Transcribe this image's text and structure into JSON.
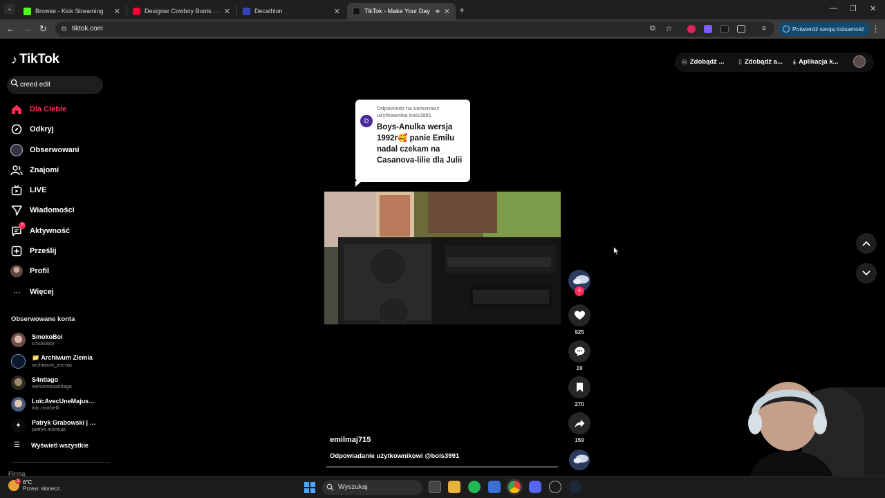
{
  "browser": {
    "tabs": [
      {
        "title": "Browse - Kick Streaming",
        "active": false
      },
      {
        "title": "Designer Cowboy Boots - YouTube",
        "active": false
      },
      {
        "title": "Decathlon",
        "active": false
      },
      {
        "title": "TikTok - Make Your Day",
        "active": true
      }
    ],
    "url": "tiktok.com",
    "verify_label": "Potwierdź swoją tożsamość"
  },
  "tiktok": {
    "logo_text": "TikTok",
    "search_value": "creed edit",
    "nav": [
      {
        "label": "Dla Ciebie",
        "icon": "home-icon",
        "active": true
      },
      {
        "label": "Odkryj",
        "icon": "compass-icon",
        "active": false
      },
      {
        "label": "Obserwowani",
        "icon": "following-avatar-icon",
        "active": false
      },
      {
        "label": "Znajomi",
        "icon": "friends-icon",
        "active": false
      },
      {
        "label": "LIVE",
        "icon": "live-icon",
        "active": false
      },
      {
        "label": "Wiadomości",
        "icon": "send-icon",
        "active": false
      },
      {
        "label": "Aktywność",
        "icon": "activity-icon",
        "active": false,
        "badge": "7"
      },
      {
        "label": "Prześlij",
        "icon": "upload-icon",
        "active": false
      },
      {
        "label": "Profil",
        "icon": "profile-avatar-icon",
        "active": false
      },
      {
        "label": "Więcej",
        "icon": "more-icon",
        "active": false
      }
    ],
    "following_title": "Obserwowane konta",
    "following": [
      {
        "name": "SmokoBoi",
        "handle": "smokoboi"
      },
      {
        "name": "📁 Archiwum Ziemia",
        "handle": "archiwum_ziemia"
      },
      {
        "name": "S4ntIago",
        "handle": "welcomesantiago"
      },
      {
        "name": "LoïcAvecUneMajuscule",
        "handle": "loic.morbelli"
      },
      {
        "name": "Patryk Grabowski | Montaż",
        "handle": "patryk.montuje"
      }
    ],
    "show_all": "Wyświetl wszystkie",
    "footer_label": "Firma",
    "top_actions": [
      {
        "label": "Zdobądź ...",
        "icon": "coin-icon"
      },
      {
        "label": "Zdobądź a...",
        "icon": "phone-icon"
      },
      {
        "label": "Aplikacja k...",
        "icon": "download-icon"
      }
    ],
    "reply": {
      "avatar_letter": "D",
      "header": "Odpowiedz na komentarz użytkownika bols3991",
      "text": "Boys-Anulka wersja 1992r🥰 panie Emilu nadal czekam na Casanova-lilie dla Julii"
    },
    "counts": {
      "likes": "925",
      "comments": "19",
      "saves": "270",
      "shares": "159"
    },
    "author": "emilmaj715",
    "caption": "Odpowiadanie użytkownikowi @bols3991"
  },
  "taskbar": {
    "temp": "6°C",
    "weather": "Przew. słonecz.",
    "weather_badge": "1",
    "search_placeholder": "Wyszukaj"
  },
  "colors": {
    "accent": "#fe2c55",
    "bg": "#000000",
    "panel": "#1e1e1e"
  }
}
